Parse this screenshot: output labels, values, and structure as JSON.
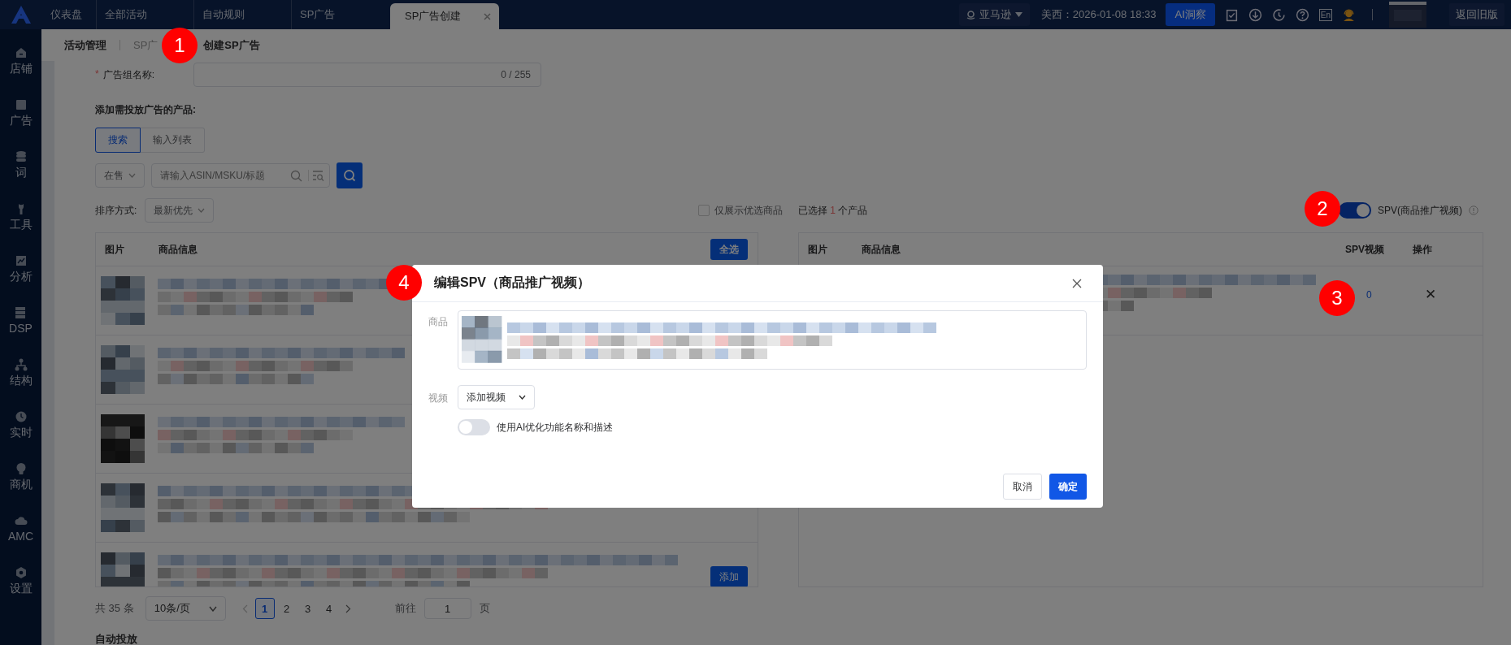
{
  "tabs": [
    {
      "label": "仪表盘",
      "selected": false
    },
    {
      "label": "全部活动",
      "selected": false
    },
    {
      "label": "自动规则",
      "selected": false
    },
    {
      "label": "SP广告",
      "selected": false
    },
    {
      "label": "SP广告创建",
      "selected": true
    }
  ],
  "top_bar": {
    "marketplace": "亚马逊",
    "clock": "美西：2026-01-08 18:33",
    "ai_button": "AI洞察",
    "language": "En",
    "back_button": "返回旧版"
  },
  "sidebar": [
    {
      "label": "店铺"
    },
    {
      "label": "广告"
    },
    {
      "label": "词"
    },
    {
      "label": "工具"
    },
    {
      "label": "分析"
    },
    {
      "label": "DSP"
    },
    {
      "label": "结构"
    },
    {
      "label": "实时"
    },
    {
      "label": "商机"
    },
    {
      "label": "AMC"
    },
    {
      "label": "设置"
    }
  ],
  "breadcrumb": [
    "活动管理",
    "SP广",
    "创建SP广告"
  ],
  "form": {
    "required_mark": "*",
    "name_label": "广告组名称:",
    "name_count": "0 / 255",
    "products_label": "添加需投放广告的产品:",
    "modes": [
      {
        "label": "搜索",
        "selected": true
      },
      {
        "label": "输入列表",
        "selected": false
      }
    ],
    "status_filter": "在售",
    "search_placeholder": "请输入ASIN/MSKU/标题",
    "sort_label": "排序方式:",
    "sort_value": "最新优先",
    "preferred_only": {
      "label": "仅展示优选商品",
      "checked": false
    }
  },
  "product_table": {
    "columns": [
      "图片",
      "商品信息"
    ],
    "select_all": "全选",
    "rows": [
      {
        "kind": "product"
      },
      {
        "kind": "product"
      },
      {
        "kind": "product"
      },
      {
        "kind": "product"
      },
      {
        "kind": "product",
        "button": "添加"
      }
    ]
  },
  "pagination": {
    "total": "共 35 条",
    "page_size": "10条/页",
    "pages": [
      {
        "label": "1",
        "selected": true
      },
      {
        "label": "2",
        "selected": false
      },
      {
        "label": "3",
        "selected": false
      },
      {
        "label": "4",
        "selected": false
      }
    ],
    "goto_label": "前往",
    "goto_value": "1",
    "page_suffix": "页"
  },
  "next_section": "自动投放",
  "selected_panel": {
    "prefix": "已选择",
    "count": "1",
    "suffix": "个产品",
    "spv_toggle": {
      "label": "SPV(商品推广视频)",
      "on": true
    },
    "columns": [
      "图片",
      "商品信息",
      "SPV视频",
      "操作"
    ],
    "rows": [
      {
        "spv_count": "0",
        "remove": "✕"
      }
    ]
  },
  "dialog": {
    "title": "编辑SPV（商品推广视频）",
    "product_label": "商品",
    "video_label": "视频",
    "video_select": "添加视频",
    "ai_toggle": {
      "label": "使用AI优化功能名称和描述",
      "on": false
    },
    "cancel": "取消",
    "confirm": "确定"
  },
  "annotations": [
    "1",
    "2",
    "3",
    "4"
  ]
}
